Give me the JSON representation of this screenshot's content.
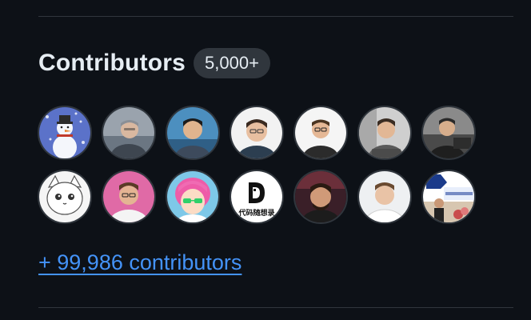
{
  "contributors": {
    "title": "Contributors",
    "count_badge": "5,000+",
    "more_link": "+ 99,986 contributors",
    "avatars": [
      {
        "name": "snowman-avatar"
      },
      {
        "name": "contributor-avatar"
      },
      {
        "name": "contributor-avatar"
      },
      {
        "name": "contributor-avatar"
      },
      {
        "name": "contributor-avatar"
      },
      {
        "name": "contributor-avatar"
      },
      {
        "name": "contributor-avatar"
      },
      {
        "name": "cartoon-cat-avatar"
      },
      {
        "name": "contributor-avatar"
      },
      {
        "name": "anime-character-avatar"
      },
      {
        "name": "logo-avatar",
        "logo_letter": "D",
        "logo_text": "代码随想录"
      },
      {
        "name": "contributor-avatar"
      },
      {
        "name": "contributor-avatar"
      },
      {
        "name": "event-banner-avatar"
      }
    ]
  },
  "colors": {
    "background": "#0d1117",
    "divider": "#30363d",
    "badge_bg": "#30363d",
    "link": "#4493f8",
    "text": "#e6edf3"
  }
}
